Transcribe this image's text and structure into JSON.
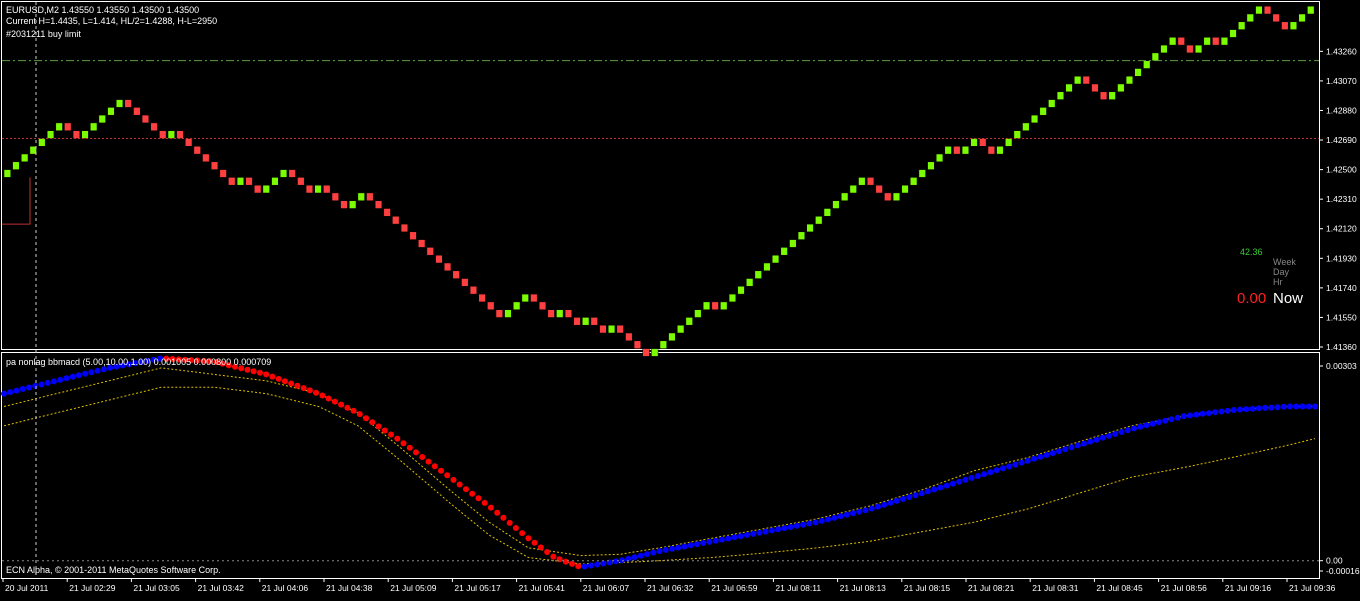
{
  "header": {
    "symbol_line": "EURUSD,M2  1.43550 1.43550 1.43500 1.43500",
    "current_line": "Current H=1.4435, L=1.414, HL/2=1.4288, H-L=2950",
    "order_label": "#2031211 buy limit"
  },
  "colors": {
    "background": "#000000",
    "frame": "#ffffff",
    "bull_brick": "#7cfc00",
    "bear_brick": "#ff4040",
    "bid_line": "#5f9f3f",
    "order_line": "#c03030",
    "macd_up": "#0000ff",
    "macd_down": "#ff0000",
    "band": "#e0c000",
    "zero_line": "#888888"
  },
  "info_box": {
    "value": "42.36",
    "labels": [
      "Week",
      "Day",
      "Hr"
    ],
    "now_value": "0.00",
    "now_label": "Now"
  },
  "indicator": {
    "title": "pa nonlag bbmacd (5.00,10.00,1.00) 0.001005 0.000800 0.000709"
  },
  "copyright": "ECN Alpha, © 2001-2011 MetaQuotes Software Corp.",
  "chart_data": [
    {
      "type": "renko",
      "name": "EURUSD,M2",
      "ylim": [
        1.4136,
        1.4341
      ],
      "y_ticks": [
        "1.43260",
        "1.43070",
        "1.42880",
        "1.42690",
        "1.42500",
        "1.42310",
        "1.42120",
        "1.41930",
        "1.41740",
        "1.41550",
        "1.41360"
      ],
      "y_tick_values": [
        1.4326,
        1.4307,
        1.4288,
        1.4269,
        1.425,
        1.4231,
        1.4212,
        1.4193,
        1.4174,
        1.4155,
        1.4136
      ],
      "brick_size": 0.0005,
      "bid_price": 1.432,
      "order_price": 1.427,
      "start_price": 1.4245,
      "pre_level": 1.4215,
      "moves": [
        1,
        1,
        1,
        1,
        1,
        1,
        1,
        -1,
        -1,
        1,
        1,
        1,
        1,
        1,
        -1,
        -1,
        -1,
        -1,
        -1,
        1,
        -1,
        -1,
        -1,
        -1,
        -1,
        -1,
        -1,
        1,
        -1,
        -1,
        1,
        1,
        1,
        -1,
        -1,
        -1,
        1,
        -1,
        -1,
        -1,
        1,
        1,
        -1,
        -1,
        -1,
        -1,
        -1,
        -1,
        -1,
        -1,
        -1,
        -1,
        -1,
        -1,
        -1,
        -1,
        -1,
        -1,
        1,
        1,
        1,
        -1,
        -1,
        -1,
        1,
        -1,
        -1,
        1,
        -1,
        -1,
        1,
        -1,
        -1,
        -1,
        -1,
        1,
        1,
        1,
        1,
        1,
        1,
        1,
        -1,
        1,
        1,
        1,
        1,
        1,
        1,
        1,
        1,
        1,
        1,
        1,
        1,
        1,
        1,
        1,
        1,
        1,
        -1,
        -1,
        -1,
        1,
        1,
        1,
        1,
        1,
        1,
        1,
        -1,
        1,
        1,
        -1,
        -1,
        1,
        1,
        1,
        1,
        1,
        1,
        1,
        1,
        1,
        1,
        -1,
        -1,
        -1,
        1,
        1,
        1,
        1,
        1,
        1,
        1,
        1,
        -1,
        -1,
        1,
        1,
        -1,
        1,
        1,
        1,
        1,
        1,
        -1,
        -1,
        -1,
        1,
        1,
        1
      ]
    },
    {
      "type": "line",
      "name": "pa nonlag bbmacd",
      "ylim": [
        -0.00016,
        0.00303
      ],
      "y_ticks": [
        "0.00303",
        "0.00",
        "-0.00016"
      ],
      "y_tick_values": [
        0.00303,
        0.0,
        -0.00016
      ],
      "macd_x": [
        0,
        4,
        8,
        12,
        16,
        18,
        20,
        24,
        27,
        30,
        34,
        37,
        40,
        42,
        44,
        47,
        50,
        54,
        58,
        62,
        66,
        70,
        74,
        78,
        82,
        86,
        90,
        94,
        98,
        100
      ],
      "macd_y": [
        0.0026,
        0.0028,
        0.003,
        0.00315,
        0.0031,
        0.003,
        0.0029,
        0.0026,
        0.0023,
        0.0019,
        0.0013,
        0.00085,
        0.00035,
        5e-05,
        -0.0001,
        0.0,
        0.00015,
        0.0003,
        0.00045,
        0.0006,
        0.0008,
        0.00105,
        0.0013,
        0.00155,
        0.0018,
        0.00205,
        0.00225,
        0.00235,
        0.0024,
        0.0024
      ],
      "macd_color_split_x": [
        [
          0,
          12,
          "up"
        ],
        [
          12,
          44,
          "down"
        ],
        [
          44,
          100,
          "up"
        ]
      ],
      "upper_band_x": [
        0,
        4,
        8,
        12,
        16,
        20,
        24,
        27,
        30,
        34,
        37,
        40,
        44,
        47,
        50,
        54,
        58,
        62,
        66,
        70,
        74,
        78,
        82,
        86,
        90,
        94,
        98,
        100
      ],
      "upper_band_y": [
        0.0024,
        0.0026,
        0.0028,
        0.003,
        0.0029,
        0.0028,
        0.0026,
        0.0023,
        0.0018,
        0.0011,
        0.0006,
        0.0002,
        8e-05,
        0.0001,
        0.0002,
        0.00035,
        0.0005,
        0.00065,
        0.00085,
        0.0011,
        0.0014,
        0.0016,
        0.00185,
        0.0021,
        0.00225,
        0.00235,
        0.0024,
        0.0024
      ],
      "lower_band_x": [
        0,
        4,
        8,
        12,
        16,
        20,
        24,
        27,
        30,
        34,
        37,
        40,
        44,
        47,
        50,
        54,
        58,
        62,
        66,
        70,
        74,
        78,
        82,
        86,
        90,
        94,
        98,
        100
      ],
      "lower_band_y": [
        0.0021,
        0.0023,
        0.0025,
        0.0027,
        0.0027,
        0.0026,
        0.0024,
        0.0021,
        0.0016,
        0.0009,
        0.0004,
        5e-05,
        -5e-05,
        -3e-05,
        0.0,
        5e-05,
        0.00012,
        0.0002,
        0.0003,
        0.00045,
        0.0006,
        0.0008,
        0.00105,
        0.0013,
        0.00145,
        0.00162,
        0.0018,
        0.0019
      ]
    }
  ],
  "time_axis": {
    "labels": [
      "20 Jul 2011",
      "21 Jul 02:29",
      "21 Jul 03:05",
      "21 Jul 03:42",
      "21 Jul 04:06",
      "21 Jul 04:38",
      "21 Jul 05:09",
      "21 Jul 05:17",
      "21 Jul 05:41",
      "21 Jul 06:07",
      "21 Jul 06:32",
      "21 Jul 06:59",
      "21 Jul 08:11",
      "21 Jul 08:13",
      "21 Jul 08:15",
      "21 Jul 08:21",
      "21 Jul 08:31",
      "21 Jul 08:45",
      "21 Jul 08:56",
      "21 Jul 09:16",
      "21 Jul 09:36"
    ]
  }
}
